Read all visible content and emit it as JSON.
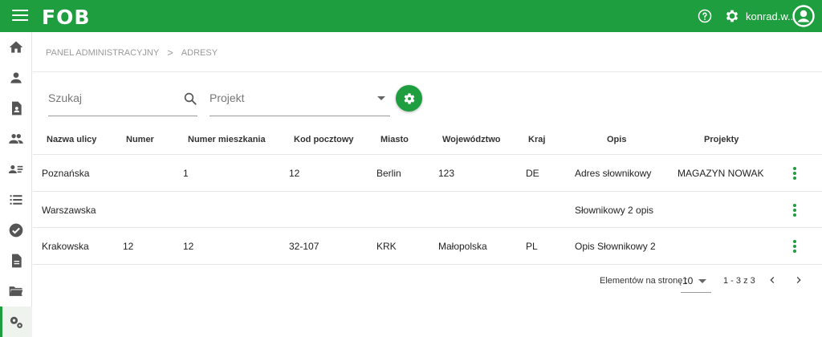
{
  "header": {
    "logo": "FOB",
    "username": "konrad.w..."
  },
  "breadcrumb": {
    "items": [
      "PANEL ADMINISTRACYJNY",
      "ADRESY"
    ],
    "separator": ">"
  },
  "filters": {
    "search_placeholder": "Szukaj",
    "project_placeholder": "Projekt"
  },
  "table": {
    "columns": [
      "Nazwa ulicy",
      "Numer",
      "Numer mieszkania",
      "Kod pocztowy",
      "Miasto",
      "Województwo",
      "Kraj",
      "Opis",
      "Projekty"
    ],
    "rows": [
      [
        "Poznańska",
        "",
        "1",
        "12",
        "Berlin",
        "123",
        "DE",
        "Adres słownikowy",
        "MAGAZYN NOWAK"
      ],
      [
        "Warszawska",
        "",
        "",
        "",
        "",
        "",
        "",
        "Słownikowy 2 opis",
        ""
      ],
      [
        "Krakowska",
        "12",
        "12",
        "32-107",
        "KRK",
        "Małopolska",
        "PL",
        "Opis Słownikowy 2",
        ""
      ]
    ]
  },
  "pagination": {
    "label": "Elementów na stronę :",
    "page_size": "10",
    "range": "1 - 3 z 3"
  },
  "colors": {
    "brand": "#1e9e3e"
  },
  "sidebar_icons": [
    "home-icon",
    "person-icon",
    "assignment-ind-icon",
    "people-icon",
    "contacts-list-icon",
    "list-icon",
    "check-circle-icon",
    "document-icon",
    "folder-open-icon",
    "settings-gears-icon"
  ]
}
